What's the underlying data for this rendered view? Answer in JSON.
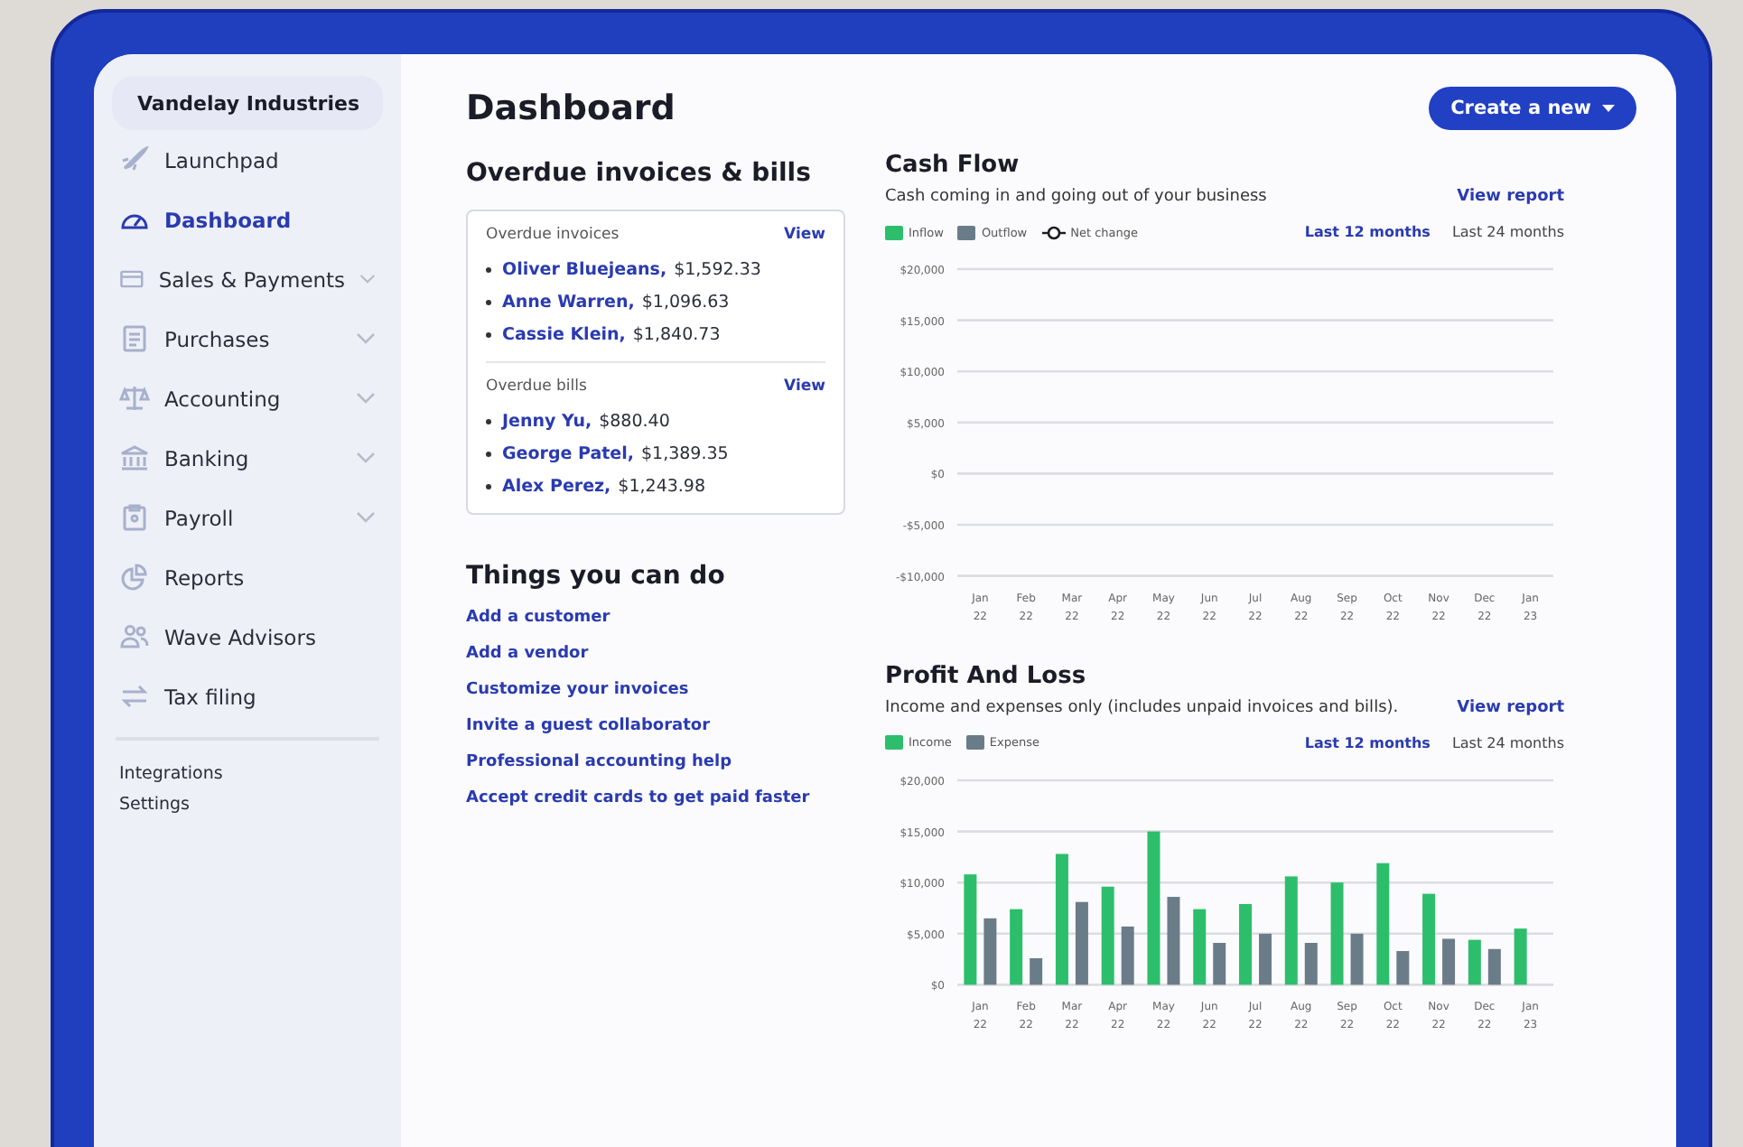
{
  "sidebar": {
    "business": "Vandelay Industries",
    "items": [
      {
        "label": "Launchpad",
        "selected": false,
        "expandable": false
      },
      {
        "label": "Dashboard",
        "selected": true,
        "expandable": false
      },
      {
        "label": "Sales & Payments",
        "selected": false,
        "expandable": true
      },
      {
        "label": "Purchases",
        "selected": false,
        "expandable": true
      },
      {
        "label": "Accounting",
        "selected": false,
        "expandable": true
      },
      {
        "label": "Banking",
        "selected": false,
        "expandable": true
      },
      {
        "label": "Payroll",
        "selected": false,
        "expandable": true
      },
      {
        "label": "Reports",
        "selected": false,
        "expandable": false
      },
      {
        "label": "Wave Advisors",
        "selected": false,
        "expandable": false
      },
      {
        "label": "Tax filing",
        "selected": false,
        "expandable": false
      }
    ],
    "footer_links": [
      "Integrations",
      "Settings"
    ]
  },
  "page_title": "Dashboard",
  "create_button": "Create a new",
  "overdue": {
    "title": "Overdue invoices & bills",
    "groups": [
      {
        "title": "Overdue invoices",
        "link": "View",
        "entries": [
          {
            "name": "Oliver Bluejeans,",
            "amount": "$1,592.33"
          },
          {
            "name": "Anne Warren,",
            "amount": "$1,096.63"
          },
          {
            "name": "Cassie Klein,",
            "amount": "$1,840.73"
          }
        ]
      },
      {
        "title": "Overdue bills",
        "link": "View",
        "entries": [
          {
            "name": "Jenny Yu,",
            "amount": "$880.40"
          },
          {
            "name": "George Patel,",
            "amount": "$1,389.35"
          },
          {
            "name": "Alex Perez,",
            "amount": "$1,243.98"
          }
        ]
      }
    ]
  },
  "things": {
    "title": "Things you can do",
    "links": [
      "Add a customer",
      "Add a vendor",
      "Customize your invoices",
      "Invite a guest collaborator",
      "Professional accounting help",
      "Accept credit cards to get paid faster"
    ]
  },
  "panels": [
    {
      "title": "Cash Flow",
      "subtitle": "Cash coming in and going out of your business",
      "link": "View report",
      "ranges": [
        {
          "label": "Last 12 months",
          "selected": true
        },
        {
          "label": "Last 24 months",
          "selected": false
        }
      ],
      "legend": [
        {
          "label": "Inflow",
          "kind": "swatch",
          "color": "#2dbe6c"
        },
        {
          "label": "Outflow",
          "kind": "swatch",
          "color": "#6b7c89"
        },
        {
          "label": "Net change",
          "kind": "line",
          "color": "#1c1c1c"
        }
      ],
      "chart_data": {
        "type": "bar",
        "grid": true,
        "categories": [
          "Jan 22",
          "Feb 22",
          "Mar 22",
          "Apr 22",
          "May 22",
          "Jun 22",
          "Jul 22",
          "Aug 22",
          "Sep 22",
          "Oct 22",
          "Nov 22",
          "Dec 22",
          "Jan 23"
        ],
        "ylim": [
          -10000,
          20000
        ],
        "yticks": [
          {
            "value": 20000,
            "label": "$20,000"
          },
          {
            "value": 15000,
            "label": "$15,000"
          },
          {
            "value": 10000,
            "label": "$10,000"
          },
          {
            "value": 5000,
            "label": "$5,000"
          },
          {
            "value": 0,
            "label": "$0"
          },
          {
            "value": -5000,
            "label": "-$5,000"
          },
          {
            "value": -10000,
            "label": "-$10,000"
          }
        ]
      }
    },
    {
      "title": "Profit And Loss",
      "subtitle": "Income and expenses only (includes unpaid invoices and bills).",
      "link": "View report",
      "ranges": [
        {
          "label": "Last 12 months",
          "selected": true
        },
        {
          "label": "Last 24 months",
          "selected": false
        }
      ],
      "chart_data": {
        "type": "bar",
        "grid": true,
        "categories": [
          "Jan 22",
          "Feb 22",
          "Mar 22",
          "Apr 22",
          "May 22",
          "Jun 22",
          "Jul 22",
          "Aug 22",
          "Sep 22",
          "Oct 22",
          "Nov 22",
          "Dec 22",
          "Jan 23"
        ],
        "ylim": [
          0,
          20000
        ],
        "yticks": [
          {
            "value": 20000,
            "label": "$20,000"
          },
          {
            "value": 15000,
            "label": "$15,000"
          },
          {
            "value": 10000,
            "label": "$10,000"
          },
          {
            "value": 5000,
            "label": "$5,000"
          },
          {
            "value": 0,
            "label": "$0"
          }
        ],
        "series": [
          {
            "name": "Income",
            "color": "#2dbe6c",
            "values": [
              10800,
              7400,
              12800,
              9600,
              15000,
              7400,
              7900,
              10600,
              10000,
              11900,
              8900,
              4400,
              5500
            ]
          },
          {
            "name": "Expense",
            "color": "#6b7c89",
            "values": [
              6500,
              2600,
              8100,
              5700,
              8600,
              4100,
              5000,
              4100,
              5000,
              3300,
              4500,
              3500,
              null
            ]
          }
        ]
      }
    }
  ]
}
